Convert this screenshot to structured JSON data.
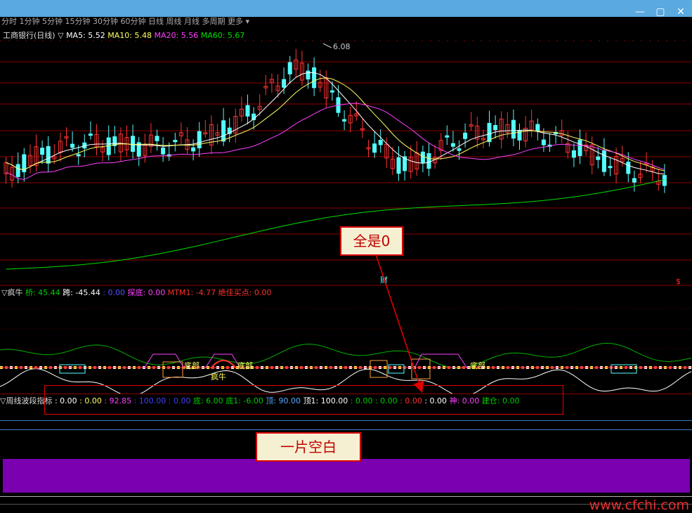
{
  "window": {
    "menu": "分时  1分钟  5分钟  15分钟  30分钟  60分钟  日线  周线  月线  多周期  更多 ▾",
    "min_icon": "—",
    "max_icon": "▢",
    "close_icon": "✕"
  },
  "main_chart": {
    "legend": {
      "name": "工商银行(日线)",
      "arrow": "▽",
      "ma5": "MA5: 5.52",
      "ma10": "MA10: 5.48",
      "ma20": "MA20: 5.56",
      "ma60": "MA60: 5.67"
    },
    "peak_label": "6.08",
    "cai_marker": "财",
    "dollar_marker": "$",
    "colors": {
      "up": "#ff3232",
      "down": "#54ffff",
      "ma5": "#ffffff",
      "ma10": "#ffff60",
      "ma20": "#ff40ff",
      "ma60": "#00e000",
      "grid": "#8b0000"
    }
  },
  "indicator1": {
    "name": "疯牛",
    "items": [
      {
        "text": "桥: 45.44",
        "color": "#00cc00"
      },
      {
        "text": "跨: -45.44",
        "color": "#ffffff"
      },
      {
        "text": ": 0.00",
        "color": "#5050ff"
      },
      {
        "text": "探底: 0.00",
        "color": "#ff40ff"
      },
      {
        "text": "MTM1: -4.77",
        "color": "#ff3030"
      },
      {
        "text": "绝佳买点: 0.00",
        "color": "#ff3030"
      }
    ],
    "marks": [
      "底部",
      "底部",
      "疯牛",
      "底部"
    ]
  },
  "indicator2": {
    "name": "周线波段指标",
    "items": [
      {
        "text": ": 0.00",
        "color": "#ffffff"
      },
      {
        "text": ": 0.00",
        "color": "#ffff60"
      },
      {
        "text": ": 92.85",
        "color": "#ff40ff"
      },
      {
        "text": ": 100.00",
        "color": "#4040ff"
      },
      {
        "text": ": 0.00",
        "color": "#4040ff"
      },
      {
        "text": "底: 6.00",
        "color": "#00cc00"
      },
      {
        "text": "底1: -6.00",
        "color": "#00cc00"
      },
      {
        "text": "顶: 90.00",
        "color": "#5aa9ff"
      },
      {
        "text": "顶1: 100.00",
        "color": "#ffffff"
      },
      {
        "text": ": 0.00",
        "color": "#00cc00"
      },
      {
        "text": ": 0.00",
        "color": "#00cc00"
      },
      {
        "text": ": 0.00",
        "color": "#ff3030"
      },
      {
        "text": ": 0.00",
        "color": "#ffffff"
      },
      {
        "text": "神: 0.00",
        "color": "#ff40ff"
      },
      {
        "text": "建仓: 0.00",
        "color": "#00cc00"
      }
    ]
  },
  "annotations": {
    "all_zero": "全是0",
    "blank": "一片空白"
  },
  "watermark": "www.cfchi.com",
  "chart_data": {
    "type": "candlestick",
    "title": "工商银行(日线)",
    "series": [
      {
        "name": "MA5",
        "value": 5.52
      },
      {
        "name": "MA10",
        "value": 5.48
      },
      {
        "name": "MA20",
        "value": 5.56
      },
      {
        "name": "MA60",
        "value": 5.67
      }
    ],
    "annotations": [
      "6.08"
    ]
  }
}
